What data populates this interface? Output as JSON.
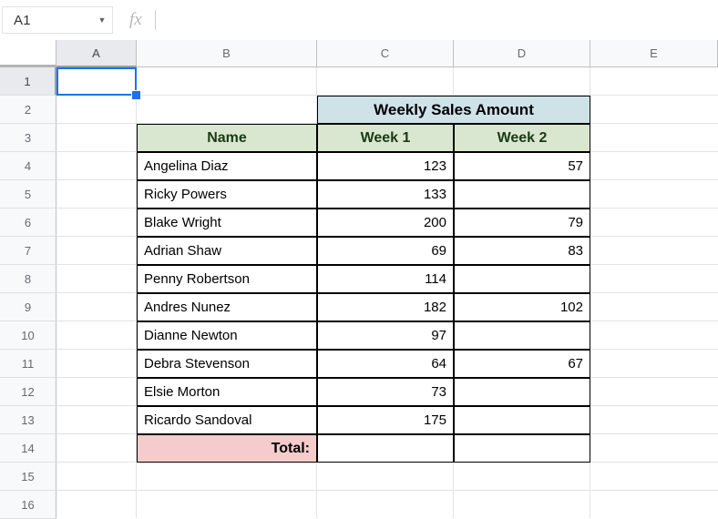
{
  "app": {
    "name_box_value": "A1",
    "name_box_caret": "▼",
    "fx_label": "fx",
    "formula_value": ""
  },
  "grid": {
    "column_headers": [
      "A",
      "B",
      "C",
      "D",
      "E"
    ],
    "selected_column": "A",
    "row_headers": [
      "1",
      "2",
      "3",
      "4",
      "5",
      "6",
      "7",
      "8",
      "9",
      "10",
      "11",
      "12",
      "13",
      "14",
      "15",
      "16"
    ],
    "selected_row": "1",
    "selected_cell": "A1"
  },
  "table": {
    "title": "Weekly Sales Amount",
    "headers": {
      "name": "Name",
      "week1": "Week 1",
      "week2": "Week 2"
    },
    "rows": [
      {
        "name": "Angelina Diaz",
        "week1": "123",
        "week2": "57"
      },
      {
        "name": "Ricky Powers",
        "week1": "133",
        "week2": ""
      },
      {
        "name": "Blake Wright",
        "week1": "200",
        "week2": "79"
      },
      {
        "name": "Adrian Shaw",
        "week1": "69",
        "week2": "83"
      },
      {
        "name": "Penny Robertson",
        "week1": "114",
        "week2": ""
      },
      {
        "name": "Andres Nunez",
        "week1": "182",
        "week2": "102"
      },
      {
        "name": "Dianne Newton",
        "week1": "97",
        "week2": ""
      },
      {
        "name": "Debra Stevenson",
        "week1": "64",
        "week2": "67"
      },
      {
        "name": "Elsie Morton",
        "week1": "73",
        "week2": ""
      },
      {
        "name": "Ricardo Sandoval",
        "week1": "175",
        "week2": ""
      }
    ],
    "total": {
      "label": "Total:",
      "week1": "",
      "week2": ""
    }
  },
  "colors": {
    "title_fill": "#cfe2e8",
    "header_fill": "#d9e7d0",
    "total_fill": "#f4cccc",
    "selection": "#1a73e8"
  }
}
